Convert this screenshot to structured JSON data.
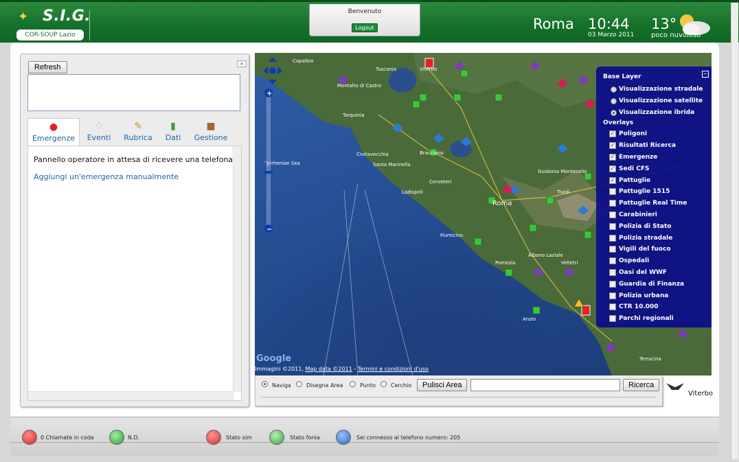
{
  "header": {
    "logo_name": "S.I.G.",
    "logo_subtitle": "COR-SOUP Lazio",
    "welcome_title": "Benvenuto",
    "logout_label": "Logout",
    "city": "Roma",
    "time": "10:44",
    "date": "03 Marzo 2011",
    "temperature": "13°",
    "weather": "poco nuvoloso",
    "colors": {
      "header_green": "#14702a",
      "accent_green": "#1b8a37"
    }
  },
  "left_panel": {
    "refresh_label": "Refresh",
    "collapse_icon": "double-chevron-icon",
    "tabs": [
      {
        "label": "Emergenze",
        "icon": "siren-icon",
        "active": true
      },
      {
        "label": "Eventi",
        "icon": "lightbulb-icon",
        "active": false
      },
      {
        "label": "Rubrica",
        "icon": "address-book-icon",
        "active": false
      },
      {
        "label": "Dati",
        "icon": "bar-chart-icon",
        "active": false
      },
      {
        "label": "Gestione",
        "icon": "box-icon",
        "active": false
      }
    ],
    "status_text": "Pannello operatore in attesa di ricevere una telefonata",
    "add_emergency_link": "Aggiungi un'emergenza manualmente"
  },
  "map": {
    "place_labels": [
      "Viterbo",
      "Roma",
      "Civitavecchia",
      "Tarquinia",
      "Fiumicino",
      "Cerveteri",
      "Ladispoli",
      "Pomezia",
      "Tivoli",
      "Guidonia Montecelio",
      "Bracciano",
      "Santa Marinella",
      "Montalto di Castro",
      "Capalbio",
      "Tuscania",
      "Albano Laziale",
      "Velletri",
      "Terracina",
      "Anzio",
      "Tyrrhenian Sea"
    ],
    "copyright_prefix": "Immagini ©2011,",
    "copyright_links": [
      "Map data ©2011",
      "Termini e condizioni d'uso"
    ],
    "google_label": "Google",
    "layer_switcher": {
      "base_title": "Base Layer",
      "base_layers": [
        {
          "label": "Visualizzazione stradale",
          "selected": false
        },
        {
          "label": "Visualizzazione satellite",
          "selected": false
        },
        {
          "label": "Visualizzazione ibrida",
          "selected": true
        }
      ],
      "overlays_title": "Overlays",
      "overlays": [
        {
          "label": "Poligoni",
          "checked": true
        },
        {
          "label": "Risultati Ricerca",
          "checked": true
        },
        {
          "label": "Emergenze",
          "checked": true
        },
        {
          "label": "Sedi CFS",
          "checked": true
        },
        {
          "label": "Pattuglie",
          "checked": true
        },
        {
          "label": "Pattuglie 1515",
          "checked": false
        },
        {
          "label": "Pattuglie Real Time",
          "checked": false
        },
        {
          "label": "Carabinieri",
          "checked": false
        },
        {
          "label": "Polizia di Stato",
          "checked": false
        },
        {
          "label": "Polizia stradale",
          "checked": false
        },
        {
          "label": "Vigili del fuoco",
          "checked": false
        },
        {
          "label": "Ospedali",
          "checked": false
        },
        {
          "label": "Oasi del WWF",
          "checked": false
        },
        {
          "label": "Guardia di Finanza",
          "checked": false
        },
        {
          "label": "Polizia urbana",
          "checked": false
        },
        {
          "label": "CTR 10.000",
          "checked": false
        },
        {
          "label": "Parchi regionali",
          "checked": false
        }
      ]
    }
  },
  "map_toolbar": {
    "modes": [
      {
        "label": "Naviga",
        "selected": true
      },
      {
        "label": "Disegna Area",
        "selected": false
      },
      {
        "label": "Punto",
        "selected": false
      },
      {
        "label": "Cerchio",
        "selected": false
      }
    ],
    "clear_area_label": "Pulisci Area",
    "search_value": "",
    "search_label": "Ricerca",
    "legend_label": "Viterbo"
  },
  "statusbar": {
    "items": [
      {
        "label": "0 Chiamate in coda",
        "icon": "phone-red-icon",
        "color": "#e03b3b"
      },
      {
        "label": "N.D.",
        "icon": "phone-green-icon",
        "color": "#3cae4e"
      },
      {
        "label": "Stato sim",
        "icon": "sim-status-icon",
        "color": "#e03b3b"
      },
      {
        "label": "Stato fonia",
        "icon": "voice-status-icon",
        "color": "#3cae4e"
      },
      {
        "label": "Sei connesso al telefono numero: 205",
        "icon": "phone-blue-icon",
        "color": "#3a78d4"
      }
    ]
  }
}
